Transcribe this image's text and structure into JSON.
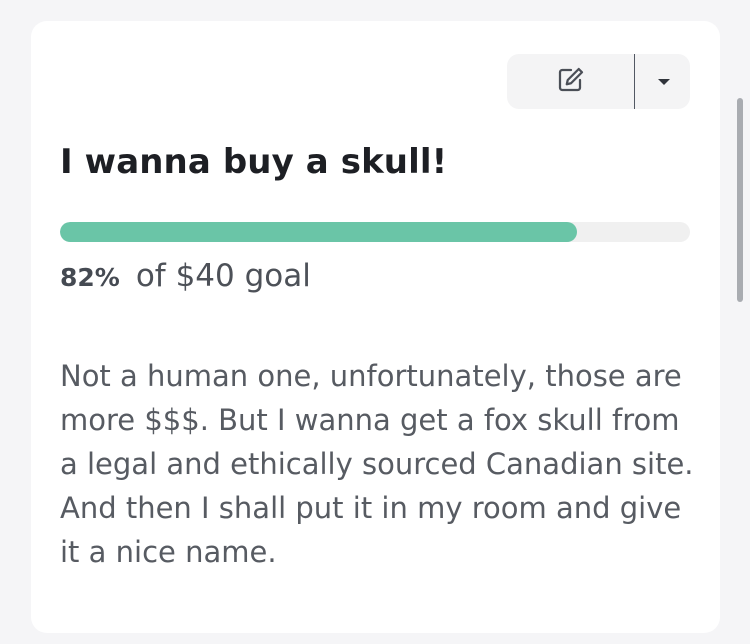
{
  "goal_card": {
    "title": "I wanna buy a skull!",
    "progress": {
      "percent": 82,
      "percent_label": "82%",
      "goal_text": "of $40 goal",
      "fill_color": "#6ac5a7"
    },
    "description": "Not a human one, unfortunately, those are more $$$. But I wanna get a fox skull from a legal and ethically sourced Canadian site. And then I shall put it in my room and give it a nice name.",
    "actions": {
      "edit_icon": "edit-icon",
      "dropdown_icon": "chevron-down-icon"
    }
  }
}
